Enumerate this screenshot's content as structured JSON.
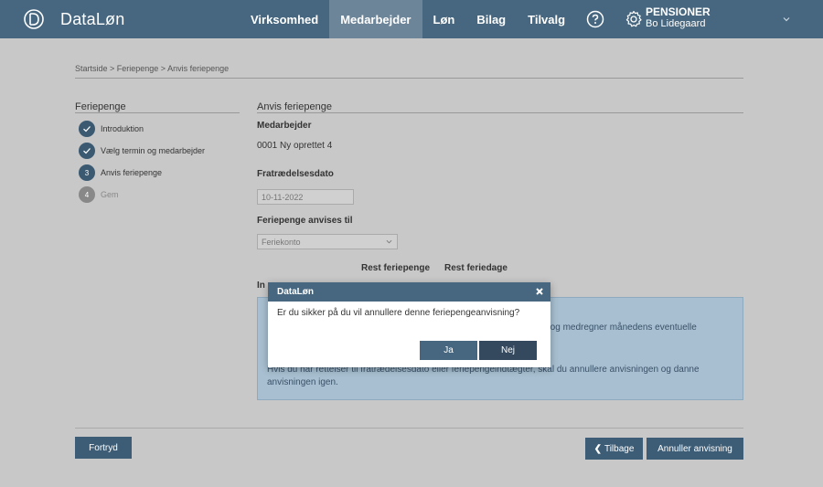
{
  "app": {
    "name": "DataLøn"
  },
  "nav": {
    "items": [
      {
        "label": "Virksomhed",
        "active": false
      },
      {
        "label": "Medarbejder",
        "active": true
      },
      {
        "label": "Løn",
        "active": false
      },
      {
        "label": "Bilag",
        "active": false
      },
      {
        "label": "Tilvalg",
        "active": false
      }
    ],
    "help_icon": "question-circle-icon",
    "settings_icon": "gear-icon"
  },
  "company": {
    "name": "PENSIONER",
    "user": "Bo Lidegaard"
  },
  "breadcrumb": "Startside > Feriepenge > Anvis feriepenge",
  "steps": {
    "title": "Feriepenge",
    "items": [
      {
        "label": "Introduktion",
        "status": "done",
        "badge": ""
      },
      {
        "label": "Vælg termin og medarbejder",
        "status": "done",
        "badge": ""
      },
      {
        "label": "Anvis feriepenge",
        "status": "current",
        "badge": "3"
      },
      {
        "label": "Gem",
        "status": "todo",
        "badge": "4"
      }
    ]
  },
  "main": {
    "title": "Anvis feriepenge",
    "employee_label": "Medarbejder",
    "employee_value": "0001 Ny oprettet 4",
    "resignation_label": "Fratrædelsesdato",
    "resignation_value": "10-11-2022",
    "paid_to_label": "Feriepenge anvises til",
    "paid_to_value": "Feriekonto",
    "col_rest_holiday_pay": "Rest feriepenge",
    "col_rest_holiday_days": "Rest feriedage",
    "row_label_partial": "In",
    "info_line1": "2) og medregner månedens eventuelle",
    "info_line2": "Hvis du har rettelser til fratrædelsesdato eller feriepengeindtægter, skal du annullere anvisningen og danne anvisningen igen."
  },
  "footer": {
    "cancel": "Fortryd",
    "back": "Tilbage",
    "annul": "Annuller anvisning"
  },
  "modal": {
    "title": "DataLøn",
    "message": "Er du sikker på du vil annullere denne feriepengeanvisning?",
    "yes": "Ja",
    "no": "Nej"
  },
  "colors": {
    "header": "#46677f",
    "nav_active": "#6d8599",
    "button": "#3d5d76",
    "info_panel": "#a7bfd0",
    "overlay_bg": "#c8c8c8"
  }
}
